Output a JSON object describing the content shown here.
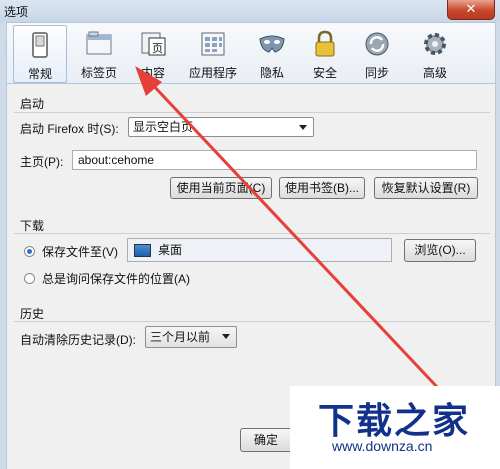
{
  "window": {
    "title": "选项",
    "close": "✕"
  },
  "toolbar": [
    {
      "label": "常规",
      "icon": "switch-icon",
      "active": true
    },
    {
      "label": "标签页",
      "icon": "tabs-window-icon"
    },
    {
      "label": "内容",
      "icon": "page-content-icon",
      "badge": "页"
    },
    {
      "label": "应用程序",
      "icon": "applications-icon"
    },
    {
      "label": "隐私",
      "icon": "mask-icon"
    },
    {
      "label": "安全",
      "icon": "padlock-icon"
    },
    {
      "label": "同步",
      "icon": "sync-icon"
    },
    {
      "label": "高级",
      "icon": "gear-icon"
    }
  ],
  "startup": {
    "title": "启动",
    "when_label": "启动 Firefox 时(S):",
    "when_value": "显示空白页",
    "homepage_label": "主页(P):",
    "homepage_value": "about:cehome",
    "buttons": [
      "使用当前页面(C)",
      "使用书签(B)...",
      "恢复默认设置(R)"
    ]
  },
  "downloads": {
    "title": "下载",
    "save_to_label": "保存文件至(V)",
    "save_to_value": "桌面",
    "browse": "浏览(O)...",
    "ask_label": "总是询问保存文件的位置(A)"
  },
  "history": {
    "title": "历史",
    "clear_label": "自动清除历史记录(D):",
    "clear_value": "三个月以前"
  },
  "dialog": {
    "ok": "确定"
  },
  "watermark": {
    "title": "下载之家",
    "url": "www.downza.cn"
  },
  "colors": {
    "arrow": "#e5403a",
    "watermark": "#12318a"
  }
}
